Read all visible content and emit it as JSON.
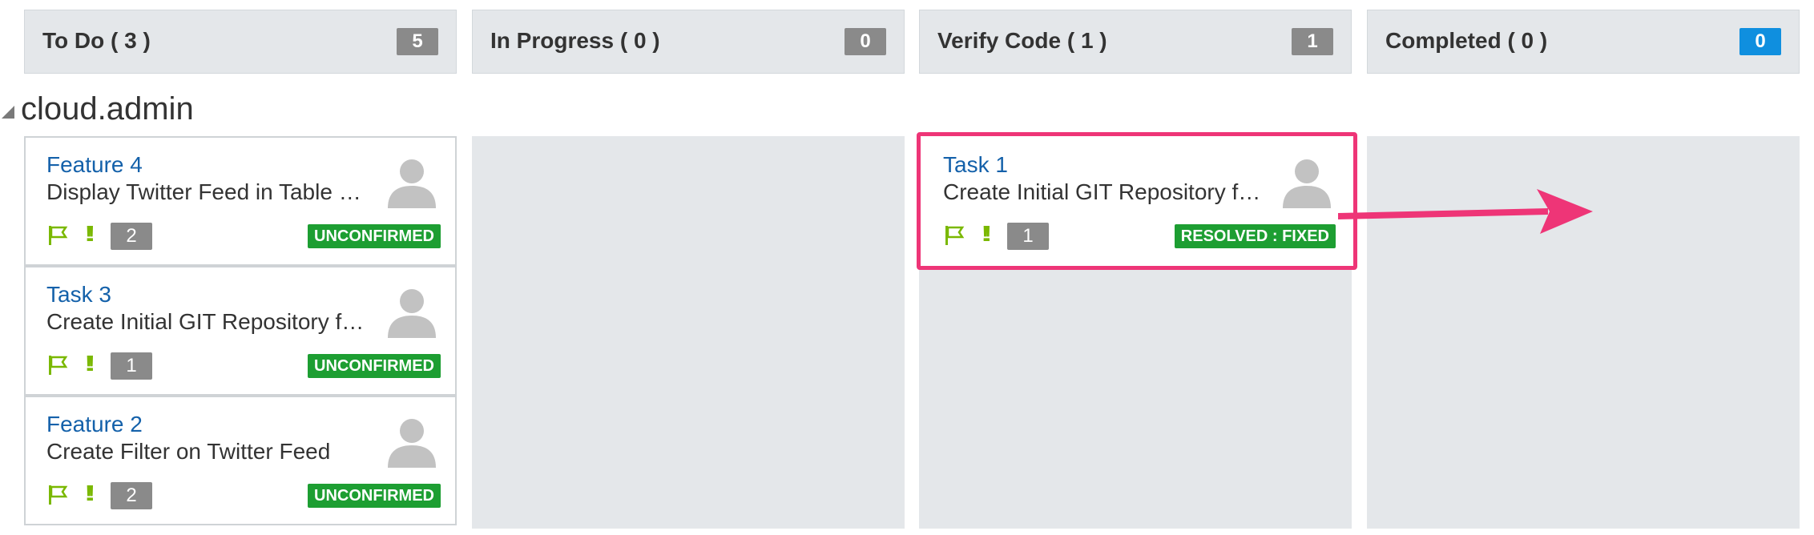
{
  "columns": [
    {
      "title": "To Do ( 3 )",
      "count": "5"
    },
    {
      "title": "In Progress ( 0 )",
      "count": "0"
    },
    {
      "title": "Verify Code ( 1 )",
      "count": "1"
    },
    {
      "title": "Completed ( 0 )",
      "count": "0"
    }
  ],
  "swimlane": {
    "label": "cloud.admin"
  },
  "cards": [
    {
      "id": "Feature 4",
      "desc": "Display Twitter Feed in Table …",
      "count": "2",
      "status": "UNCONFIRMED"
    },
    {
      "id": "Task 3",
      "desc": "Create Initial GIT Repository f…",
      "count": "1",
      "status": "UNCONFIRMED"
    },
    {
      "id": "Feature 2",
      "desc": "Create Filter on Twitter Feed",
      "count": "2",
      "status": "UNCONFIRMED"
    },
    {
      "id": "Task 1",
      "desc": "Create Initial GIT Repository f…",
      "count": "1",
      "status": "RESOLVED : FIXED"
    }
  ],
  "colors": {
    "link": "#1461aa",
    "status_green": "#1d9e32",
    "priority_green": "#7ab800",
    "highlight_pink": "#ee3577",
    "completed_badge_blue": "#0f8fdf",
    "count_gray": "#8a8a8a"
  },
  "icons": {
    "flag": "flag-icon",
    "priority": "priority-icon",
    "avatar": "user-avatar-icon",
    "collapse": "collapse-triangle-icon",
    "arrow": "drag-arrow-icon"
  }
}
